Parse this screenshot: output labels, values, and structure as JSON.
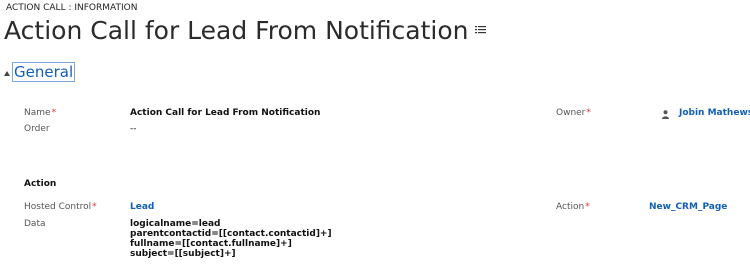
{
  "header": {
    "breadcrumb": "ACTION CALL : INFORMATION",
    "title": "Action Call for Lead From Notification",
    "title_menu_icon": "list-menu-icon"
  },
  "section": {
    "title": "General",
    "collapse_icon": "triangle-up-icon"
  },
  "fields": {
    "name": {
      "label": "Name",
      "required": "*",
      "value": "Action Call for Lead From Notification"
    },
    "order": {
      "label": "Order",
      "value": "--"
    },
    "owner": {
      "label": "Owner",
      "required": "*",
      "value": "Jobin Mathews",
      "icon": "user-icon"
    },
    "action_header": "Action",
    "hosted_control": {
      "label": "Hosted Control",
      "required": "*",
      "value": "Lead"
    },
    "action": {
      "label": "Action",
      "required": "*",
      "value": "New_CRM_Page"
    },
    "data": {
      "label": "Data",
      "lines": [
        "logicalname=lead",
        "parentcontactid=[[contact.contactid]+]",
        "fullname=[[contact.fullname]+]",
        "subject=[[subject]+]"
      ]
    }
  },
  "colors": {
    "link": "#1160b7",
    "required": "#e03030",
    "label": "#555555"
  }
}
